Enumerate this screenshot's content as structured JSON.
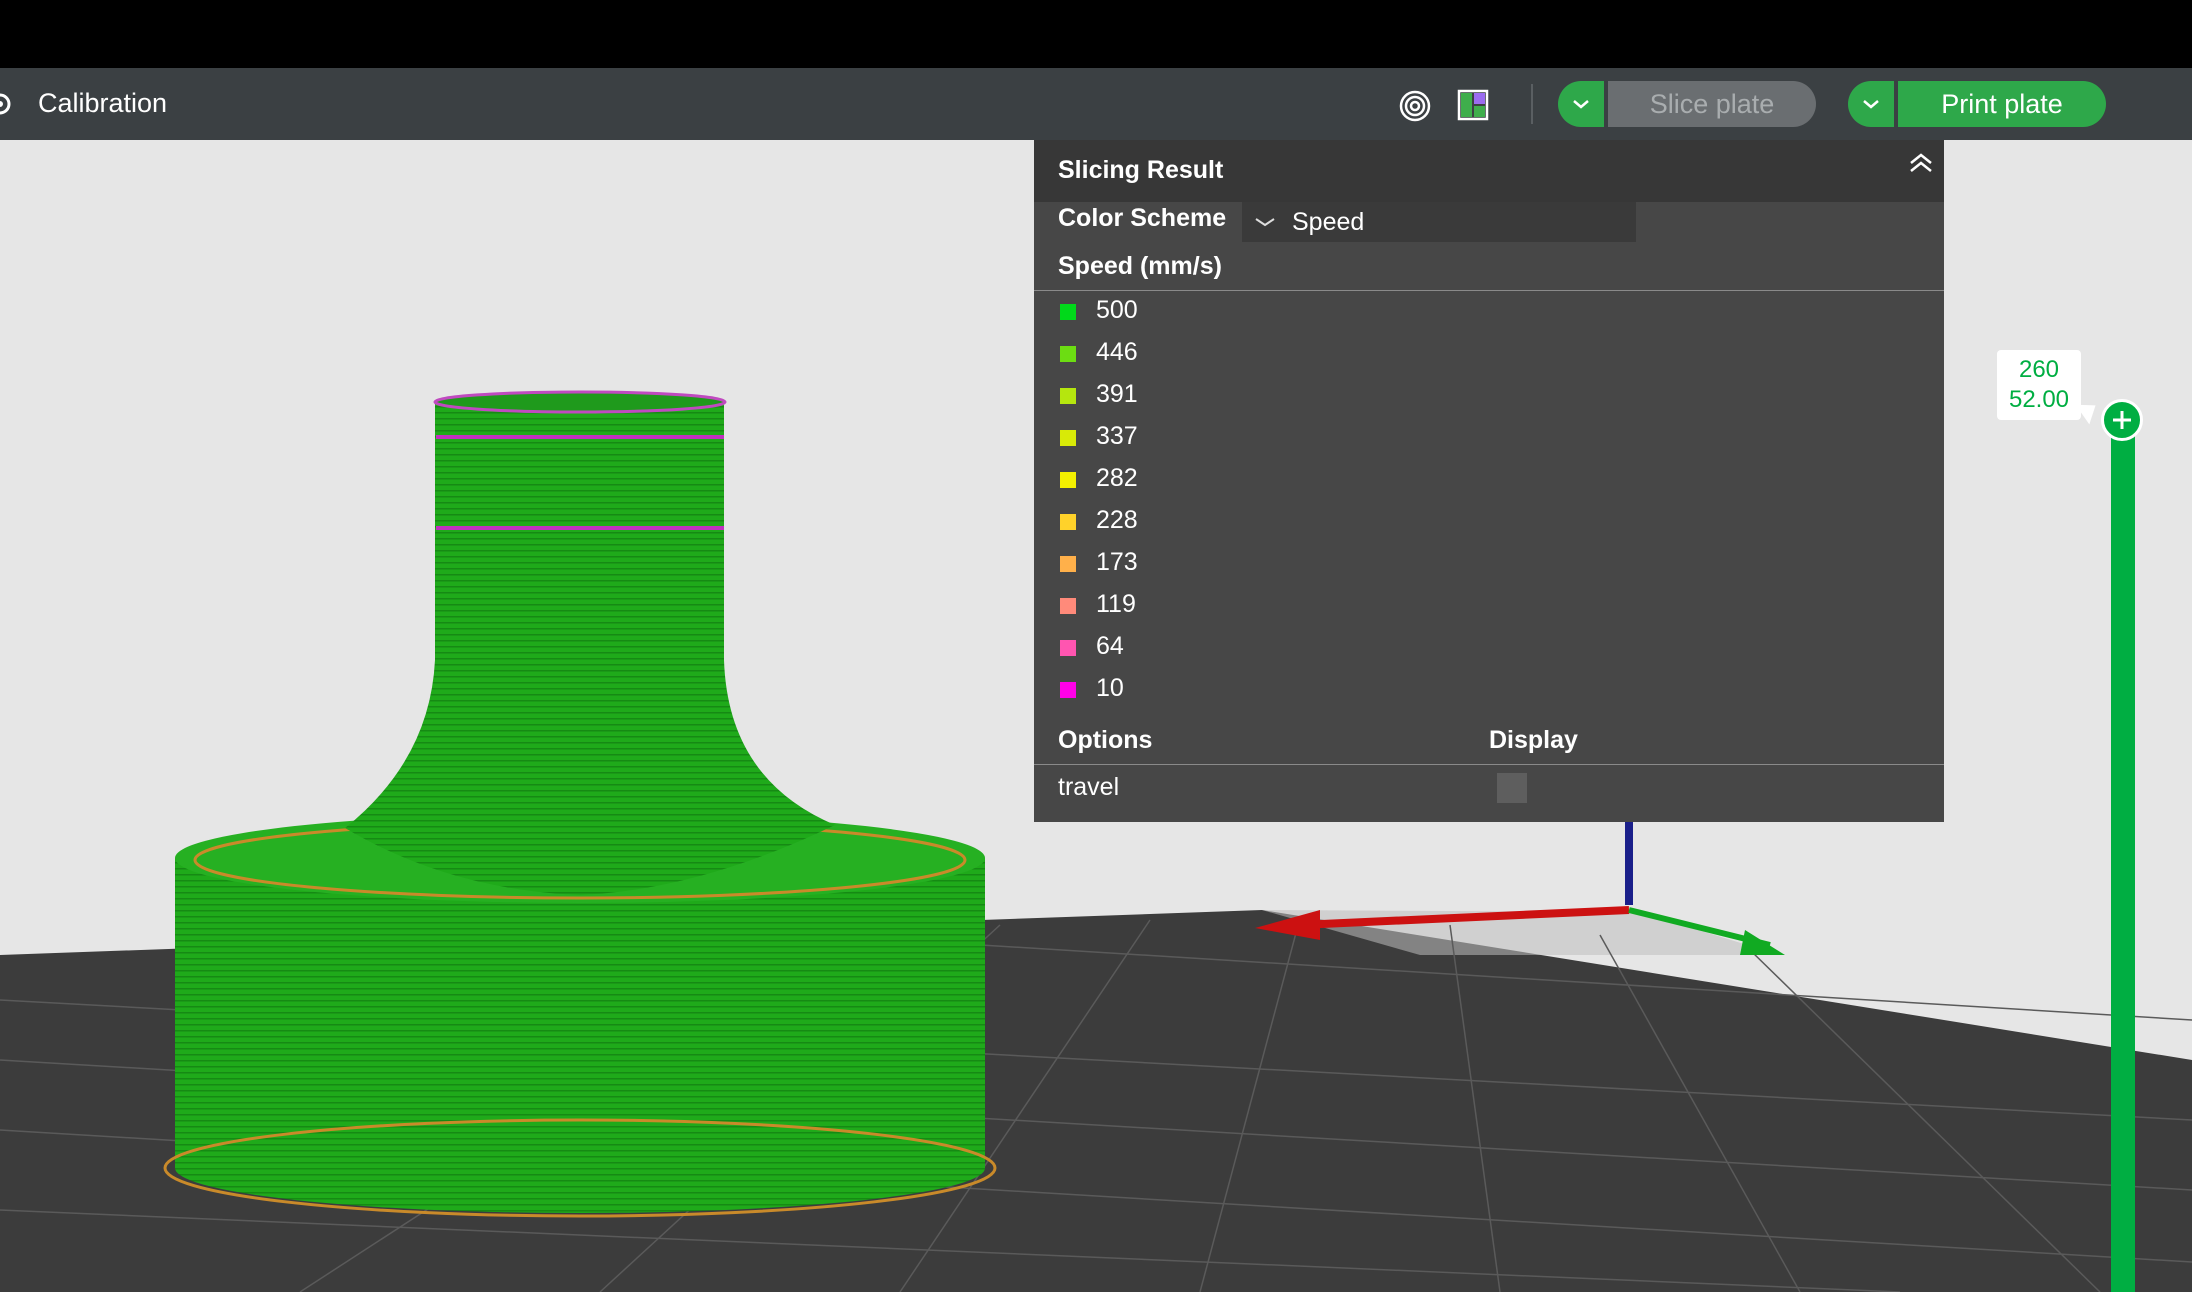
{
  "toolbar": {
    "title": "Calibration",
    "slice_label": "Slice plate",
    "print_label": "Print plate",
    "icons": [
      "gear-icon",
      "layers-icon",
      "layout-icon",
      "chevron-down-icon"
    ]
  },
  "panel": {
    "title": "Slicing Result",
    "color_scheme_label": "Color Scheme",
    "color_scheme_value": "Speed",
    "legend_title": "Speed (mm/s)",
    "legend": [
      {
        "value": "500",
        "color": "#00d91a"
      },
      {
        "value": "446",
        "color": "#6cdd12"
      },
      {
        "value": "391",
        "color": "#b5e60e"
      },
      {
        "value": "337",
        "color": "#d8ea07"
      },
      {
        "value": "282",
        "color": "#f4f000"
      },
      {
        "value": "228",
        "color": "#ffd22a"
      },
      {
        "value": "173",
        "color": "#ffb04a"
      },
      {
        "value": "119",
        "color": "#ff8a7a"
      },
      {
        "value": "64",
        "color": "#ff55b0"
      },
      {
        "value": "10",
        "color": "#ff00e8"
      }
    ],
    "options_label": "Options",
    "display_label": "Display",
    "travel_label": "travel",
    "travel_checked": false
  },
  "layer_slider": {
    "layer": "260",
    "height": "52.00"
  },
  "colors": {
    "accent": "#00ae42",
    "model": "#22b020",
    "bed": "#3a3a3a"
  }
}
